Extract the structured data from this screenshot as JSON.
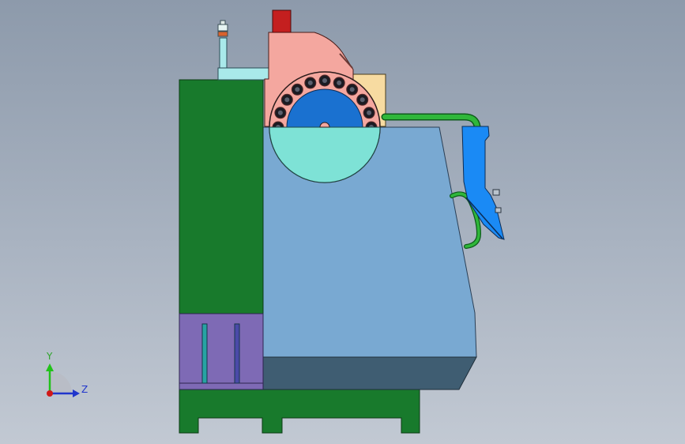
{
  "triad": {
    "y_label": "Y",
    "z_label": "Z"
  },
  "colors": {
    "background_top": "#8d9aab",
    "background_bottom": "#c2c9d3",
    "base": "#187a2c",
    "column": "#187a2c",
    "purple_panel": "#7e6ab5",
    "body": "#79a9d2",
    "body_bottom": "#3f5d72",
    "head_housing": "#f4a79f",
    "head_cap": "#c41f1f",
    "turret_bg": "#f7dba1",
    "turret_disc": "#1a71d0",
    "turret_lower": "#7ee2d6",
    "chute": "#1a8af5",
    "pipe": "#2fb73a",
    "top_block": "#a9e9ea",
    "axis_y": "#21c21a",
    "axis_z": "#2036cc",
    "axis_origin": "#d11818"
  }
}
